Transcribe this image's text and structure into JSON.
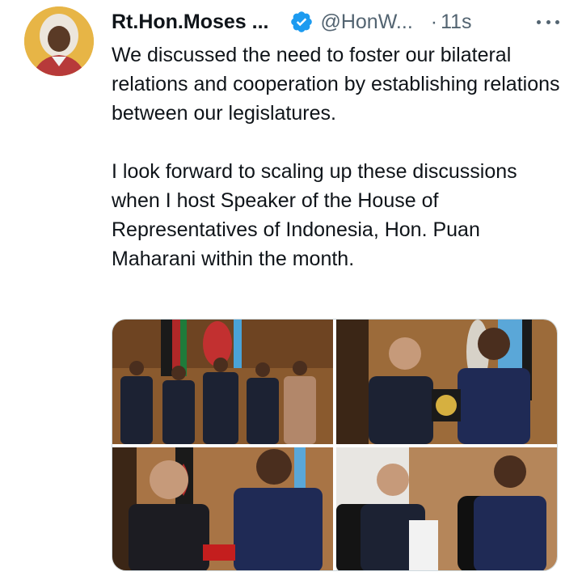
{
  "tweet": {
    "author": {
      "display_name": "Rt.Hon.Moses ...",
      "handle": "@HonW...",
      "verified_icon": "verified-badge-icon",
      "verified_color": "#1d9bf0"
    },
    "separator": "·",
    "time_ago": "11s",
    "more_icon": "more-horizontal-icon",
    "text": {
      "paragraph_1": "We discussed the need to foster our bilateral relations and cooperation by establishing relations between our legislatures.",
      "paragraph_2": "I look forward to scaling up these discussions when I host Speaker of the House of Representatives of Indonesia, Hon. Puan Maharani within the month."
    },
    "media": {
      "photos": [
        {
          "name": "group-photo"
        },
        {
          "name": "plaque-presentation-photo"
        },
        {
          "name": "gift-exchange-photo"
        },
        {
          "name": "seated-meeting-photo"
        }
      ]
    }
  },
  "colors": {
    "text_primary": "#0f1419",
    "text_secondary": "#536471",
    "accent": "#1d9bf0",
    "border": "#cfd9de"
  }
}
